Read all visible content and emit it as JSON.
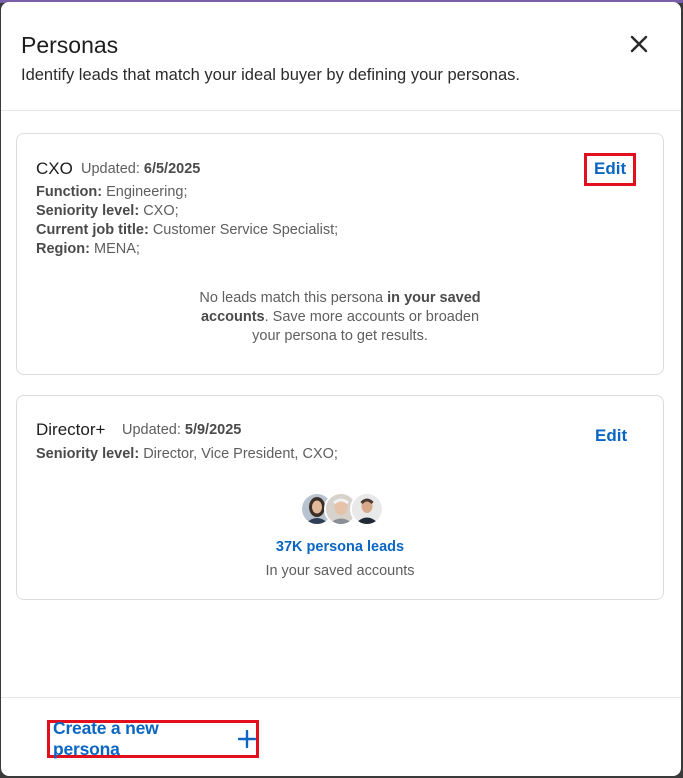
{
  "dialog": {
    "title": "Personas",
    "subtitle": "Identify leads that match your ideal buyer by defining your personas."
  },
  "personas": [
    {
      "name": "CXO",
      "updated_label": "Updated:",
      "updated_date": "6/5/2025",
      "edit_label": "Edit",
      "attributes": [
        {
          "key": "Function:",
          "value": "Engineering;"
        },
        {
          "key": "Seniority level:",
          "value": "CXO;"
        },
        {
          "key": "Current job title:",
          "value": "Customer Service Specialist;"
        },
        {
          "key": "Region:",
          "value": "MENA;"
        }
      ],
      "empty_message": {
        "part1": "No leads match this persona ",
        "bold": "in your saved accounts",
        "part2": ". Save more accounts or broaden your persona to get results."
      }
    },
    {
      "name": "Director+",
      "updated_label": "Updated:",
      "updated_date": "5/9/2025",
      "edit_label": "Edit",
      "attributes": [
        {
          "key": "Seniority level:",
          "value": "Director, Vice President, CXO;"
        }
      ],
      "leads_count_label": "37K persona leads",
      "leads_sub_label": "In your saved accounts"
    }
  ],
  "footer": {
    "create_label": "Create a new persona"
  },
  "icons": {
    "close": "close-icon",
    "plus": "plus-icon"
  },
  "colors": {
    "accent": "#0a66c2",
    "highlight": "#e2101f",
    "text": "#1d1d1d",
    "muted": "#5e5e5e"
  }
}
